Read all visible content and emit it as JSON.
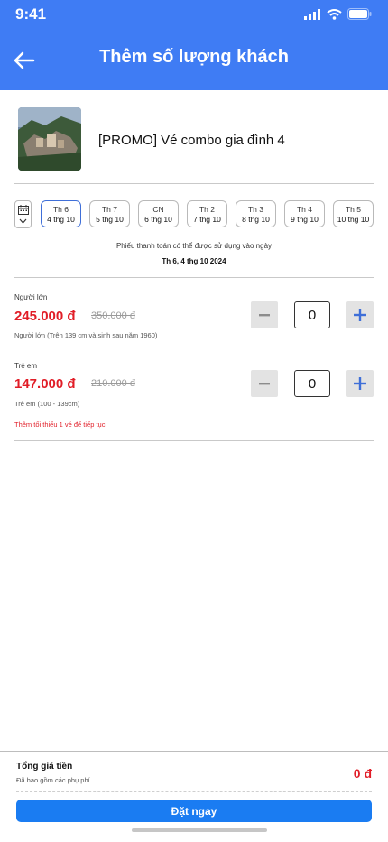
{
  "status_bar": {
    "time": "9:41"
  },
  "header": {
    "title": "Thêm số lượng khách",
    "accent": "#3f7cf4"
  },
  "product": {
    "title": "[PROMO] Vé combo gia đình 4"
  },
  "dates": [
    {
      "dow": "Th 6",
      "dm": "4 thg 10",
      "selected": true
    },
    {
      "dow": "Th 7",
      "dm": "5 thg 10",
      "selected": false
    },
    {
      "dow": "CN",
      "dm": "6 thg 10",
      "selected": false
    },
    {
      "dow": "Th 2",
      "dm": "7 thg 10",
      "selected": false
    },
    {
      "dow": "Th 3",
      "dm": "8 thg 10",
      "selected": false
    },
    {
      "dow": "Th 4",
      "dm": "9 thg 10",
      "selected": false
    },
    {
      "dow": "Th 5",
      "dm": "10 thg 10",
      "selected": false
    }
  ],
  "voucher_note": {
    "text": "Phiếu thanh toán có thể được sử dụng vào ngày",
    "date": "Th 6, 4 thg 10 2024"
  },
  "tickets": [
    {
      "label": "Người lớn",
      "price": "245.000 đ",
      "old_price": "350.000 đ",
      "desc": "Người lớn (Trên 139 cm và sinh sau năm 1960)",
      "qty": "0"
    },
    {
      "label": "Trẻ em",
      "price": "147.000 đ",
      "old_price": "210.000 đ",
      "desc": "Trẻ em (100 - 139cm)",
      "qty": "0"
    }
  ],
  "warning": "Thêm tối thiểu 1 vé để tiếp tục",
  "footer": {
    "total_label": "Tổng giá tiền",
    "total_sub": "Đã bao gồm các phụ phí",
    "total_value": "0 đ",
    "book_label": "Đặt ngay",
    "price_color": "#e11d27",
    "button_color": "#1a7cf2"
  }
}
